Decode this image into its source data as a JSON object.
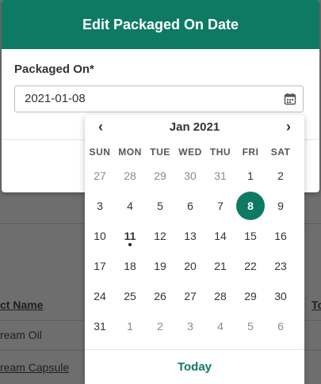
{
  "modal": {
    "title": "Edit Packaged On Date",
    "field_label": "Packaged On*",
    "date_value": "2021-01-08",
    "calendar_icon": "calendar-icon"
  },
  "calendar": {
    "month_label": "Jan 2021",
    "prev_icon": "chevron-left-icon",
    "next_icon": "chevron-right-icon",
    "weekdays": [
      "SUN",
      "MON",
      "TUE",
      "WED",
      "THU",
      "FRI",
      "SAT"
    ],
    "weeks": [
      [
        {
          "d": "27",
          "o": true
        },
        {
          "d": "28",
          "o": true
        },
        {
          "d": "29",
          "o": true
        },
        {
          "d": "30",
          "o": true
        },
        {
          "d": "31",
          "o": true
        },
        {
          "d": "1"
        },
        {
          "d": "2"
        }
      ],
      [
        {
          "d": "3"
        },
        {
          "d": "4"
        },
        {
          "d": "5"
        },
        {
          "d": "6"
        },
        {
          "d": "7"
        },
        {
          "d": "8",
          "sel": true
        },
        {
          "d": "9"
        }
      ],
      [
        {
          "d": "10"
        },
        {
          "d": "11",
          "today": true
        },
        {
          "d": "12"
        },
        {
          "d": "13"
        },
        {
          "d": "14"
        },
        {
          "d": "15"
        },
        {
          "d": "16"
        }
      ],
      [
        {
          "d": "17"
        },
        {
          "d": "18"
        },
        {
          "d": "19"
        },
        {
          "d": "20"
        },
        {
          "d": "21"
        },
        {
          "d": "22"
        },
        {
          "d": "23"
        }
      ],
      [
        {
          "d": "24"
        },
        {
          "d": "25"
        },
        {
          "d": "26"
        },
        {
          "d": "27"
        },
        {
          "d": "28"
        },
        {
          "d": "29"
        },
        {
          "d": "30"
        }
      ],
      [
        {
          "d": "31"
        },
        {
          "d": "1",
          "o": true
        },
        {
          "d": "2",
          "o": true
        },
        {
          "d": "3",
          "o": true
        },
        {
          "d": "4",
          "o": true
        },
        {
          "d": "5",
          "o": true
        },
        {
          "d": "6",
          "o": true
        }
      ]
    ],
    "today_label": "Today",
    "selected_color": "#0e7a63"
  },
  "background": {
    "column_header": "ct Name",
    "column_header_right": "To",
    "row1": "ream Oil",
    "row2": "ream Capsule"
  }
}
